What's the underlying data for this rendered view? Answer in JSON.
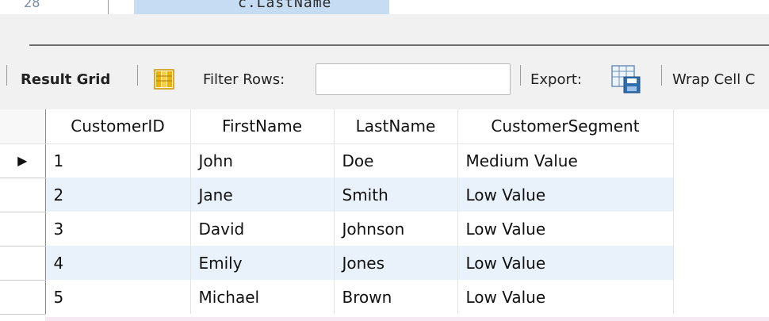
{
  "editor": {
    "line_number": "28",
    "code_line": "c.LastName"
  },
  "toolbar": {
    "result_grid_label": "Result Grid",
    "filter_label": "Filter Rows:",
    "filter_value": "",
    "export_label": "Export:",
    "wrap_label": "Wrap Cell C",
    "icons": [
      "grid-layout-icon",
      "export-icon"
    ]
  },
  "grid": {
    "columns": [
      "CustomerID",
      "FirstName",
      "LastName",
      "CustomerSegment"
    ],
    "current_row_marker": "▶",
    "rows": [
      [
        "1",
        "John",
        "Doe",
        "Medium Value"
      ],
      [
        "2",
        "Jane",
        "Smith",
        "Low Value"
      ],
      [
        "3",
        "David",
        "Johnson",
        "Low Value"
      ],
      [
        "4",
        "Emily",
        "Jones",
        "Low Value"
      ],
      [
        "5",
        "Michael",
        "Brown",
        "Low Value"
      ]
    ]
  },
  "colors": {
    "accent_highlight": "#c6dcf2",
    "alt_row": "#e9f2fb",
    "grid_icon": "#f0b400",
    "export_icon": "#2f6fb0"
  }
}
